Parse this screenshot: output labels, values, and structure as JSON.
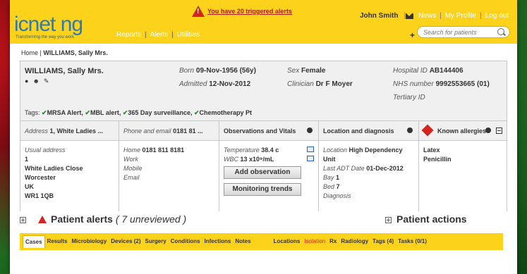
{
  "header": {
    "logo_text": "icnet ng",
    "logo_tagline": "Transforming the way you work",
    "nav": [
      "Reports",
      "Alerts",
      "Utilities"
    ],
    "alert_banner": "You have 20 triggered alerts",
    "user_name": "John Smith",
    "links": [
      "News",
      "My Profile",
      "Log out"
    ],
    "search_placeholder": "Search for patients"
  },
  "breadcrumb": {
    "home": "Home",
    "current": "WILLIAMS, Sally Mrs."
  },
  "patient": {
    "name": "WILLIAMS, Sally Mrs.",
    "born_label": "Born",
    "born_value": "09-Nov-1956 (56y)",
    "admitted_label": "Admitted",
    "admitted_value": "12-Nov-2012",
    "sex_label": "Sex",
    "sex_value": "Female",
    "clinician_label": "Clinician",
    "clinician_value": "Dr F Moyer",
    "hospital_id_label": "Hospital ID",
    "hospital_id_value": "AB144406",
    "nhs_label": "NHS number",
    "nhs_value": "9992553665 (01)",
    "tertiary_label": "Tertiary ID",
    "tags_label": "Tags:",
    "tags": [
      "MRSA Alert,",
      "MBL alert,",
      "365 Day surveillance,",
      "Chemotherapy Pt"
    ]
  },
  "columns": {
    "address": {
      "head_label": "Address",
      "head_value": "1, White Ladies ...",
      "usual_label": "Usual address",
      "lines": [
        "1",
        "White Ladies Close",
        "Worcester",
        "UK",
        "WR1 1QB"
      ]
    },
    "phone": {
      "head_label": "Phone and email",
      "head_value": "0181 81 ...",
      "home_label": "Home",
      "home_value": "0181 811 8181",
      "work_label": "Work",
      "mobile_label": "Mobile",
      "email_label": "Email"
    },
    "obs": {
      "head": "Observations and Vitals",
      "temp_label": "Temperature",
      "temp_value": "38.4 c",
      "wbc_label": "WBC",
      "wbc_value": "13 x10⁹/mL",
      "add_button": "Add observation",
      "trends_button": "Monitoring trends"
    },
    "location": {
      "head": "Location and diagnosis",
      "location_label": "Location",
      "location_value": "High Dependency Unit",
      "adt_label": "Last ADT Date",
      "adt_value": "01-Dec-2012",
      "bay_label": "Bay",
      "bay_value": "1",
      "bed_label": "Bed",
      "bed_value": "7",
      "diagnosis_label": "Diagnosis"
    },
    "allergies": {
      "head": "Known allergies",
      "items": [
        "Latex",
        "Penicillin"
      ]
    }
  },
  "alerts": {
    "title": "Patient alerts",
    "count_text": "( 7 unreviewed )"
  },
  "actions": {
    "title": "Patient actions"
  },
  "tabs": [
    "Cases",
    "Results",
    "Microbiology",
    "Devices (2)",
    "Surgery",
    "Conditions",
    "Infections",
    "Notes",
    "Locations",
    "Isolation",
    "Rx",
    "Radiology",
    "Tags (4)",
    "Tasks (0/1)"
  ],
  "colors": {
    "header_yellow": "#fcd21a",
    "alert_red": "#d6231d",
    "logo_blue": "#2b7bb8"
  }
}
